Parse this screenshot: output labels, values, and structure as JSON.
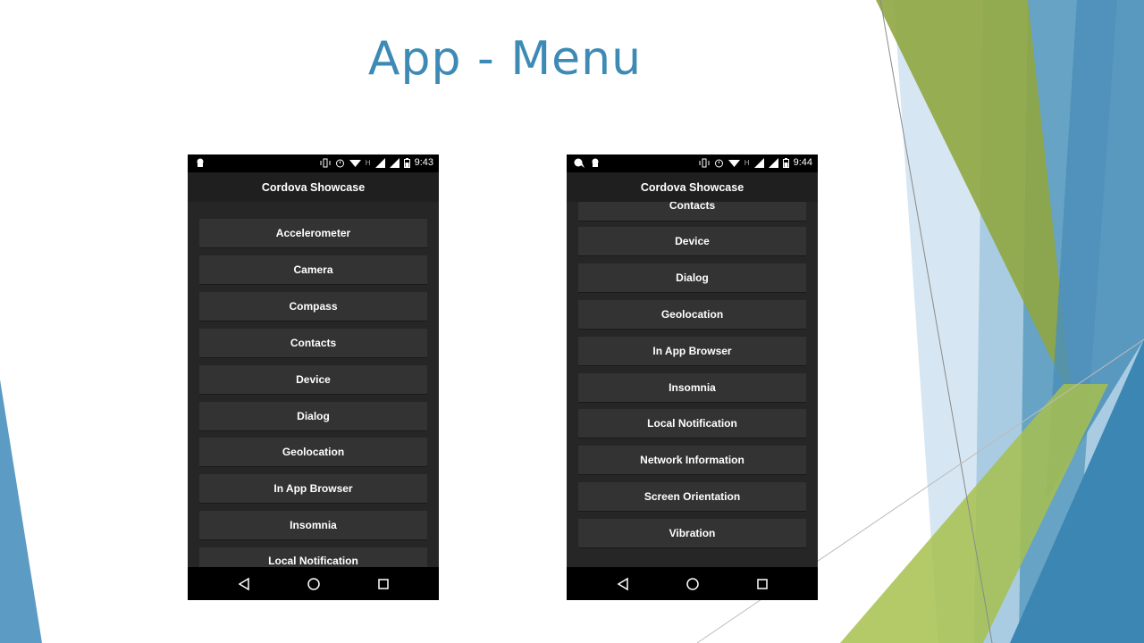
{
  "slide": {
    "title": "App - Menu"
  },
  "colors": {
    "title": "#3d8ab5",
    "accent_green": "#9bb54a",
    "accent_blue": "#4a90bd"
  },
  "phones": [
    {
      "status": {
        "time": "9:43",
        "network": "H"
      },
      "appbar_title": "Cordova Showcase",
      "items": [
        "Accelerometer",
        "Camera",
        "Compass",
        "Contacts",
        "Device",
        "Dialog",
        "Geolocation",
        "In App Browser",
        "Insomnia",
        "Local Notification"
      ]
    },
    {
      "status": {
        "time": "9:44",
        "network": "H"
      },
      "appbar_title": "Cordova Showcase",
      "items": [
        "Contacts",
        "Device",
        "Dialog",
        "Geolocation",
        "In App Browser",
        "Insomnia",
        "Local Notification",
        "Network Information",
        "Screen Orientation",
        "Vibration"
      ]
    }
  ],
  "icons": [
    "android-icon",
    "vibrate-icon",
    "alarm-icon",
    "wifi-icon",
    "signal-icon",
    "battery-icon",
    "back-icon",
    "home-icon",
    "recents-icon"
  ]
}
